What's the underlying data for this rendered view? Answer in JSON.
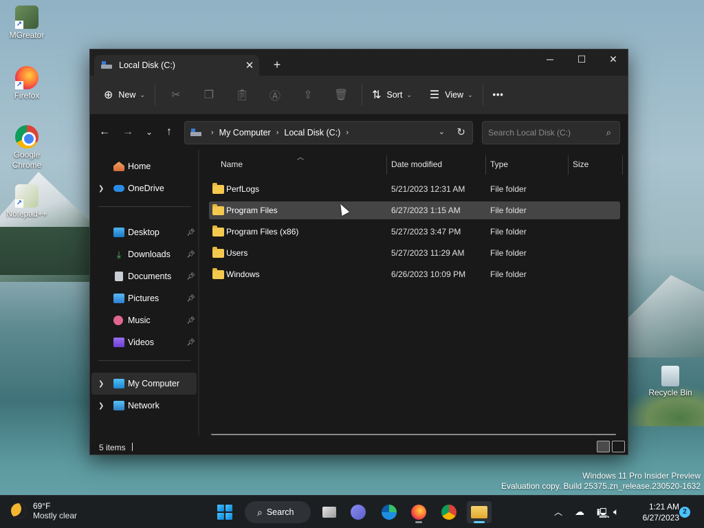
{
  "desktop": {
    "icons": [
      {
        "label": "MGreator",
        "icon": "mcreator-icon"
      },
      {
        "label": "Firefox",
        "icon": "firefox-icon"
      },
      {
        "label": "Google Chrome",
        "icon": "chrome-icon"
      },
      {
        "label": "Notepad++",
        "icon": "notepad-plus-plus-icon"
      },
      {
        "label": "Recycle Bin",
        "icon": "recycle-bin-icon"
      }
    ]
  },
  "explorer": {
    "tab_title": "Local Disk (C:)",
    "toolbar": {
      "new_label": "New",
      "sort_label": "Sort",
      "view_label": "View",
      "more_label": "•••"
    },
    "address": {
      "crumbs": [
        "My Computer",
        "Local Disk (C:)"
      ]
    },
    "search": {
      "placeholder": "Search Local Disk (C:)"
    },
    "sidebar": {
      "items": [
        {
          "label": "Home",
          "icon": "home-icon",
          "expandable": false
        },
        {
          "label": "OneDrive",
          "icon": "onedrive-icon",
          "expandable": true
        },
        {
          "label": "Desktop",
          "icon": "desktop-folder-icon",
          "pinned": true
        },
        {
          "label": "Downloads",
          "icon": "downloads-icon",
          "pinned": true
        },
        {
          "label": "Documents",
          "icon": "documents-icon",
          "pinned": true
        },
        {
          "label": "Pictures",
          "icon": "pictures-icon",
          "pinned": true
        },
        {
          "label": "Music",
          "icon": "music-icon",
          "pinned": true
        },
        {
          "label": "Videos",
          "icon": "videos-icon",
          "pinned": true
        },
        {
          "label": "My Computer",
          "icon": "computer-icon",
          "expandable": true,
          "selected": true
        },
        {
          "label": "Network",
          "icon": "network-icon",
          "expandable": true
        }
      ]
    },
    "columns": {
      "name": "Name",
      "date": "Date modified",
      "type": "Type",
      "size": "Size"
    },
    "files": [
      {
        "name": "PerfLogs",
        "date": "5/21/2023 12:31 AM",
        "type": "File folder",
        "size": ""
      },
      {
        "name": "Program Files",
        "date": "6/27/2023 1:15 AM",
        "type": "File folder",
        "size": "",
        "selected": true
      },
      {
        "name": "Program Files (x86)",
        "date": "5/27/2023 3:47 PM",
        "type": "File folder",
        "size": ""
      },
      {
        "name": "Users",
        "date": "5/27/2023 11:29 AM",
        "type": "File folder",
        "size": ""
      },
      {
        "name": "Windows",
        "date": "6/26/2023 10:09 PM",
        "type": "File folder",
        "size": ""
      }
    ],
    "status": {
      "item_count": "5 items"
    }
  },
  "watermark": {
    "line1": "Windows 11 Pro Insider Preview",
    "line2": "Evaluation copy. Build 25375.zn_release.230520-1632"
  },
  "taskbar": {
    "weather": {
      "temp": "69°F",
      "condition": "Mostly clear"
    },
    "search_label": "Search",
    "clock": {
      "time": "1:21 AM",
      "date": "6/27/2023"
    },
    "notification_count": "2"
  },
  "colors": {
    "folder": "#f4c94e",
    "accent": "#60cdff",
    "window_bg": "#191919",
    "toolbar_bg": "#2c2c2c"
  }
}
